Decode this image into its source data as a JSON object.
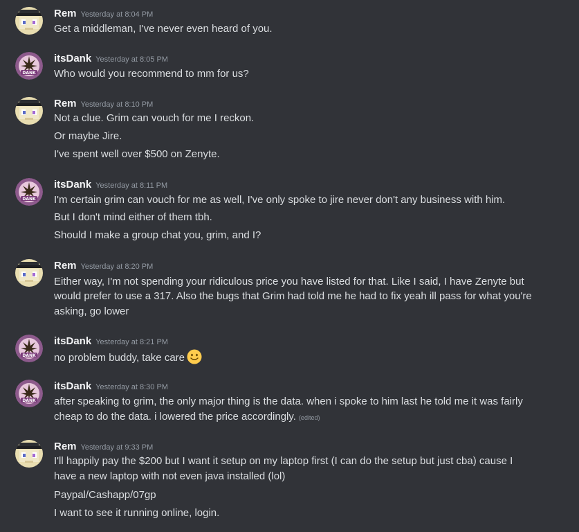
{
  "users": {
    "rem": {
      "name": "Rem",
      "avatar_icon": "pixel-character-icon"
    },
    "dank": {
      "name": "itsDank",
      "avatar_icon": "cannabis-leaf-icon",
      "avatar_badge": "DANK"
    }
  },
  "messages": [
    {
      "user": "Rem",
      "time": "Yesterday at 8:04 PM",
      "lines": [
        "Get a middleman, I've never even heard of you."
      ]
    },
    {
      "user": "itsDank",
      "time": "Yesterday at 8:05 PM",
      "lines": [
        "Who would you recommend to mm for us?"
      ]
    },
    {
      "user": "Rem",
      "time": "Yesterday at 8:10 PM",
      "lines": [
        "Not a clue. Grim can vouch for me I reckon.",
        "Or maybe Jire.",
        "I've spent well over $500 on Zenyte."
      ]
    },
    {
      "user": "itsDank",
      "time": "Yesterday at 8:11 PM",
      "lines": [
        "I'm certain grim can vouch for me as well, I've only spoke to jire never don't any business with him.",
        "But I don't mind either of them tbh.",
        "Should I make a group chat you, grim, and I?"
      ]
    },
    {
      "user": "Rem",
      "time": "Yesterday at 8:20 PM",
      "lines": [
        "Either way, I'm not spending your ridiculous price you have listed for that. Like I said, I have Zenyte but",
        "would prefer to use a 317. Also the bugs that Grim had told me he had to fix yeah ill pass for what you're",
        "asking, go lower"
      ]
    },
    {
      "user": "itsDank",
      "time": "Yesterday at 8:21 PM",
      "lines": [
        "no problem buddy, take care"
      ],
      "emoji": "slightly-smiling-face-icon"
    },
    {
      "user": "itsDank",
      "time": "Yesterday at 8:30 PM",
      "lines": [
        "after speaking to grim, the only major thing is the data. when i spoke to him last he told me it was fairly",
        "cheap to do the data. i lowered the price accordingly."
      ],
      "edited": "(edited)"
    },
    {
      "user": "Rem",
      "time": "Yesterday at 9:33 PM",
      "lines": [
        "I'll happily pay the $200 but I want it setup on my laptop first (I can do the setup but just cba) cause I",
        "have a new laptop with not even java installed (lol)",
        "Paypal/Cashapp/07gp",
        "I want to see it running online, login."
      ]
    }
  ],
  "colors": {
    "background": "#313338",
    "username": "#f2f3f5",
    "timestamp": "#949ba4",
    "text": "#dbdee1"
  }
}
